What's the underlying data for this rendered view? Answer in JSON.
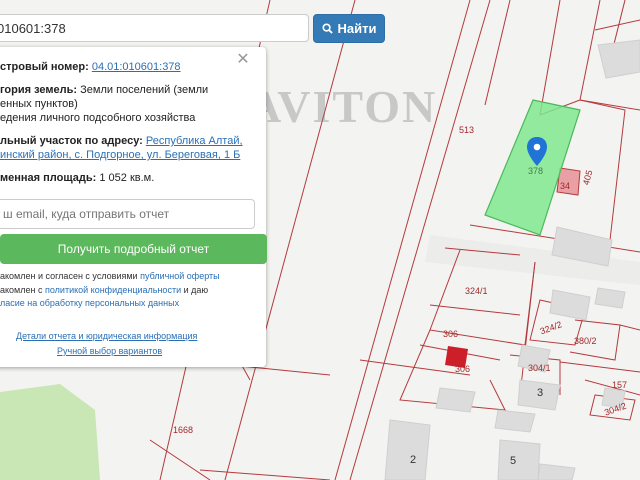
{
  "search": {
    "value": "010601:378",
    "button_label": "Найти"
  },
  "watermark": "GRAVITON",
  "panel": {
    "cadastral_label": "стровый номер:",
    "cadastral_value": "04.01:010601:378",
    "category_label": "гория земель:",
    "category_value_1": "Земли поселений (земли",
    "category_value_2": "енных пунктов)",
    "use_value": "едения личного подсобного хозяйства",
    "address_label": "льный участок по адресу:",
    "address_value_1": "Республика Алтай,",
    "address_value_2": "инский район, с. Подгорное, ул. Береговая, 1 Б",
    "area_label": "менная площадь:",
    "area_value": "1 052 кв.м.",
    "email_placeholder": "ш email, куда отправить отчет",
    "report_button": "Получить подробный отчет",
    "agree_1_prefix": "акомлен и согласен с условиями",
    "agree_1_link": "публичной оферты",
    "agree_2_prefix": "акомлен с",
    "agree_2_link": "политикой конфиденциальности",
    "agree_2_suffix": "и даю",
    "agree_3_link": "ласие на обработку персональных данных",
    "details_link": "Детали отчета и юридическая информация",
    "manual_link": "Ручной выбор вариантов"
  },
  "map": {
    "labels": {
      "l513": "513",
      "l378": "378",
      "l34": "34",
      "l405": "405",
      "l3241": "324/1",
      "l306a": "306",
      "l306b": "306",
      "l3242": "324/2",
      "l3802": "380/2",
      "l3041": "304/1",
      "l157": "157",
      "l3042": "304/2",
      "l1668": "1668",
      "b3": "3",
      "b2": "2",
      "b5": "5"
    }
  },
  "colors": {
    "highlight": "#7fe88f",
    "boundary": "#b53a3d",
    "accent": "#337ab7",
    "green_button": "#5cb85c",
    "building_red": "#cc1f2a"
  }
}
